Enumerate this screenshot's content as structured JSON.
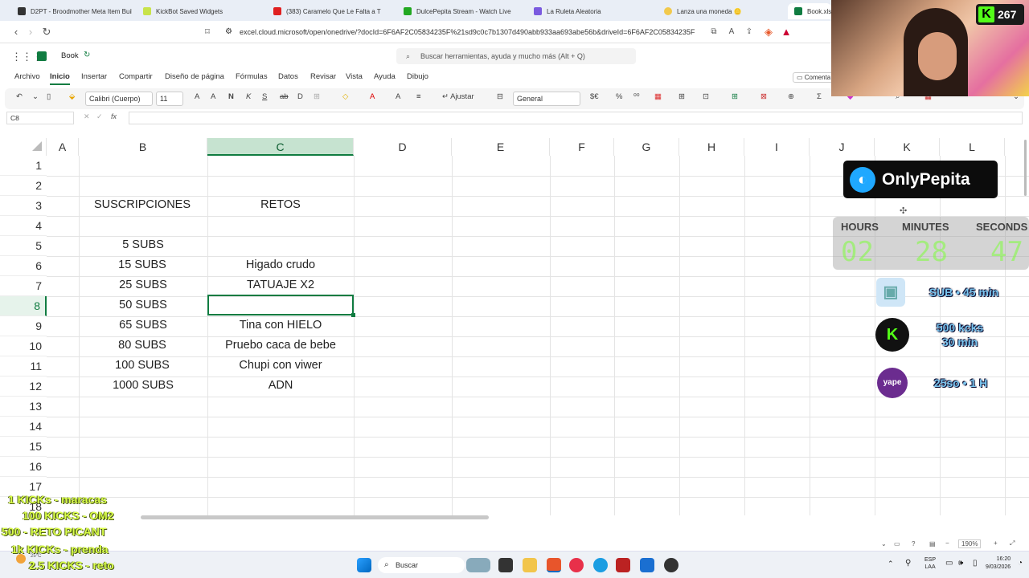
{
  "browser": {
    "tabs": [
      {
        "label": "D2PT - Broodmother Meta Item Buil",
        "color": "#333"
      },
      {
        "label": "KickBot Saved Widgets",
        "color": "#c8e34a"
      },
      {
        "label": "(383) Caramelo Que Le Falta a T",
        "color": "#e02020"
      },
      {
        "label": "DulcePepita Stream - Watch Live",
        "color": "#22a822"
      },
      {
        "label": "La Ruleta Aleatoria",
        "color": "#7a5adf"
      },
      {
        "label": "Lanza una moneda 🪙",
        "color": "#f2c94c"
      },
      {
        "label": "Book.xls",
        "color": "#107c41"
      }
    ],
    "url": "excel.cloud.microsoft/open/onedrive/?docId=6F6AF2C05834235F%21sd9c0c7b1307d490abb933aa693abe56b&driveId=6F6AF2C05834235F"
  },
  "excel": {
    "book_name": "Book",
    "search_placeholder": "Buscar herramientas, ayuda y mucho más (Alt + Q)",
    "menus": [
      "Archivo",
      "Inicio",
      "Insertar",
      "Compartir",
      "Diseño de página",
      "Fórmulas",
      "Datos",
      "Revisar",
      "Vista",
      "Ayuda",
      "Dibujo"
    ],
    "comment_label": "Comenta",
    "font_name": "Calibri (Cuerpo)",
    "font_size": "11",
    "wrap_label": "Ajustar",
    "number_format": "General",
    "name_box": "C8",
    "columns": [
      "A",
      "B",
      "C",
      "D",
      "E",
      "F",
      "G",
      "H",
      "I",
      "J",
      "K",
      "L"
    ],
    "rows": [
      "1",
      "2",
      "3",
      "4",
      "5",
      "6",
      "7",
      "8",
      "9",
      "10",
      "11",
      "12",
      "13",
      "14",
      "15",
      "16",
      "17",
      "18"
    ],
    "cells": {
      "B3": "SUSCRIPCIONES",
      "C3": "RETOS",
      "B5": "5 SUBS",
      "B6": "15 SUBS",
      "C6": "Higado crudo",
      "B7": "25 SUBS",
      "C7": "TATUAJE X2",
      "B8": "50 SUBS",
      "B9": "65 SUBS",
      "C9": "Tina con HIELO",
      "B10": "80 SUBS",
      "C10": "Pruebo caca de bebe",
      "B11": "100 SUBS",
      "C11": "Chupi con viwer",
      "B12": "1000 SUBS",
      "C12": "ADN"
    },
    "zoom": "190%"
  },
  "overlay": {
    "kick_count": "267",
    "brand": "OnlyPepita",
    "timer": {
      "hours_label": "HOURS",
      "minutes_label": "MINUTES",
      "seconds_label": "SECONDS",
      "hours": "02",
      "minutes": "28",
      "seconds": "47"
    },
    "rewards": [
      "SUB • 45 min",
      "500 kcks\n30 min",
      "25so • 1 H"
    ],
    "kick_rules": [
      "1 KICKs - maracas",
      "100 KICKS - OM2",
      "500 - RETO PICANT",
      "1k KICKs - prenda",
      "2.5 KICKS - reto"
    ]
  },
  "taskbar": {
    "search_label": "Buscar",
    "lang": "ESP",
    "lang2": "LAA",
    "time": "16:20",
    "date": "9/03/2026",
    "weather": "25°C"
  }
}
